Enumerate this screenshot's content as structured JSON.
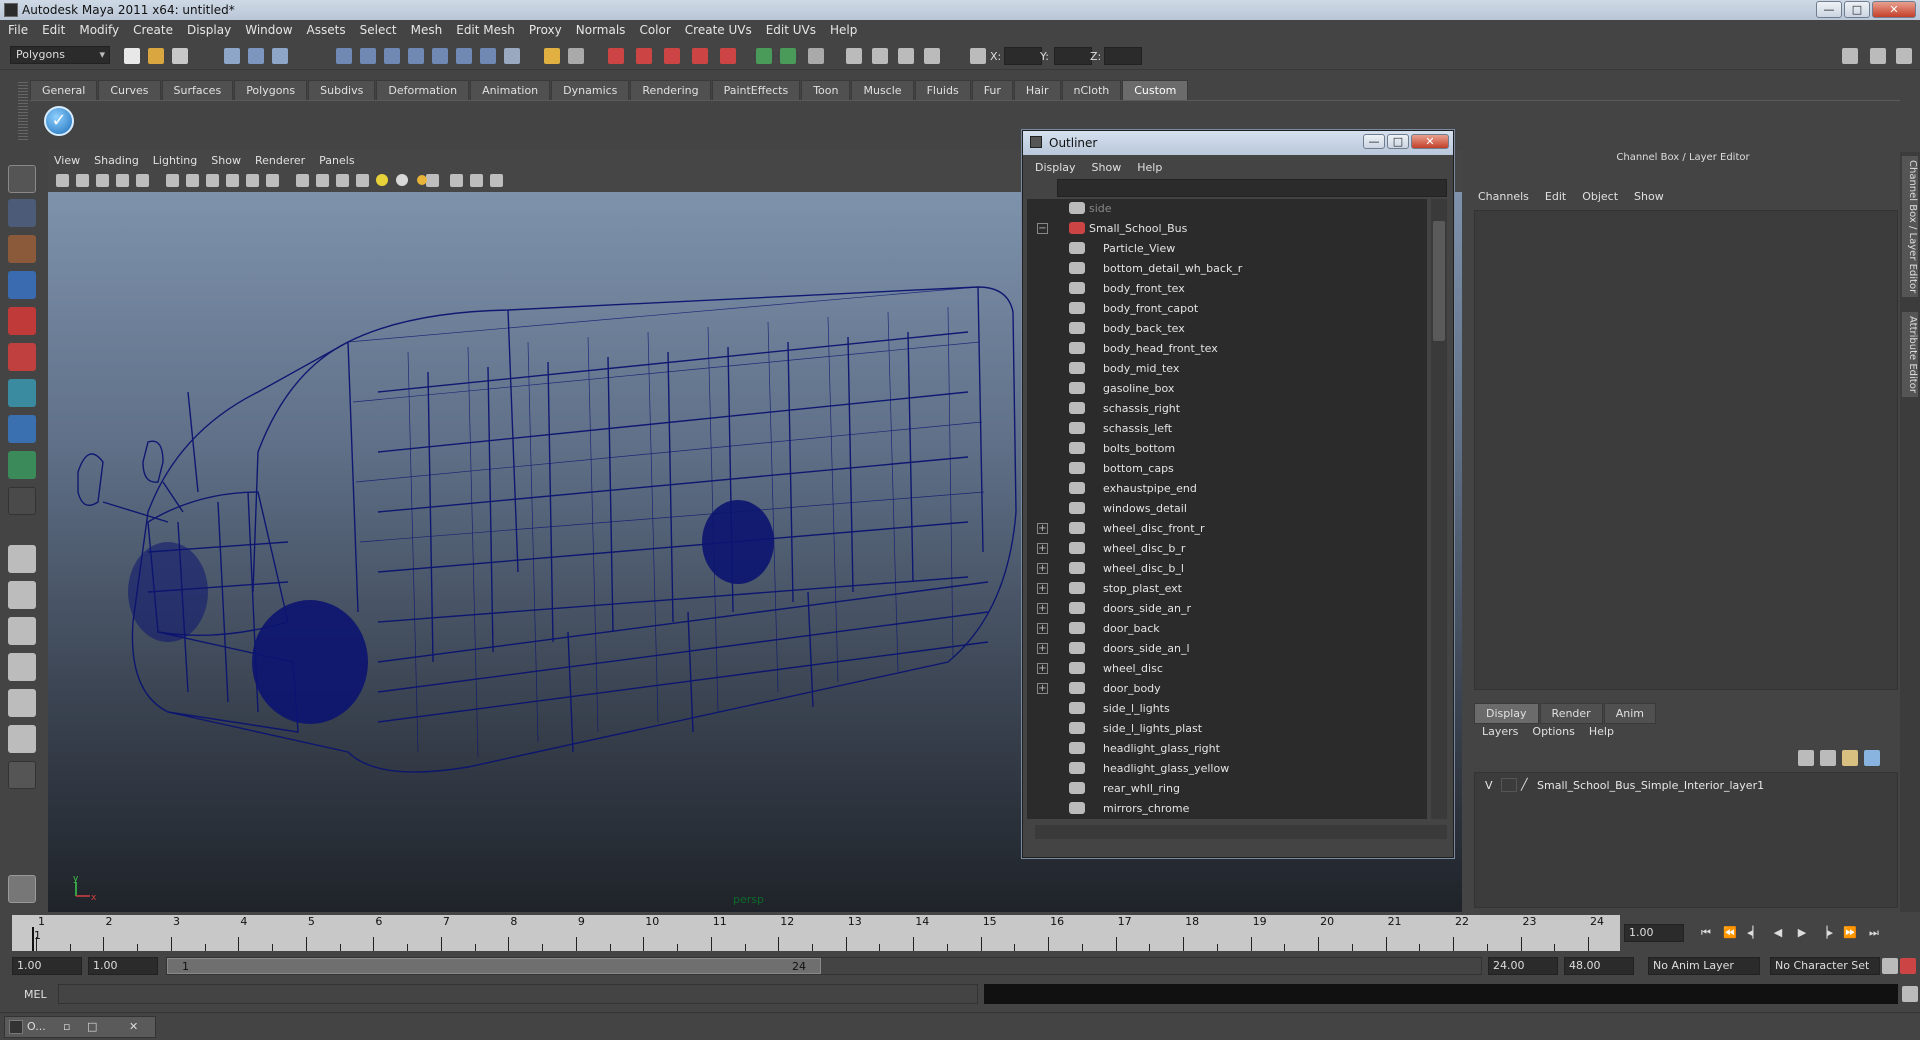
{
  "window": {
    "title": "Autodesk Maya 2011 x64: untitled*"
  },
  "menubar": [
    "File",
    "Edit",
    "Modify",
    "Create",
    "Display",
    "Window",
    "Assets",
    "Select",
    "Mesh",
    "Edit Mesh",
    "Proxy",
    "Normals",
    "Color",
    "Create UVs",
    "Edit UVs",
    "Help"
  ],
  "statusline": {
    "mode": "Polygons",
    "x_label": "X:",
    "y_label": "Y:",
    "z_label": "Z:"
  },
  "shelf_tabs": [
    "General",
    "Curves",
    "Surfaces",
    "Polygons",
    "Subdivs",
    "Deformation",
    "Animation",
    "Dynamics",
    "Rendering",
    "PaintEffects",
    "Toon",
    "Muscle",
    "Fluids",
    "Fur",
    "Hair",
    "nCloth",
    "Custom"
  ],
  "shelf_active": "Custom",
  "viewport": {
    "menu": [
      "View",
      "Shading",
      "Lighting",
      "Show",
      "Renderer",
      "Panels"
    ],
    "camera": "persp",
    "axis_y": "y",
    "axis_x": "x"
  },
  "outliner": {
    "title": "Outliner",
    "menu": [
      "Display",
      "Show",
      "Help"
    ],
    "items": [
      {
        "label": "side",
        "indent": 0,
        "dim": true,
        "expand": ""
      },
      {
        "label": "Small_School_Bus",
        "indent": 1,
        "dim": false,
        "expand": "−"
      },
      {
        "label": "Particle_View",
        "indent": 2,
        "dim": false,
        "expand": ""
      },
      {
        "label": "bottom_detail_wh_back_r",
        "indent": 2,
        "dim": false,
        "expand": ""
      },
      {
        "label": "body_front_tex",
        "indent": 2,
        "dim": false,
        "expand": ""
      },
      {
        "label": "body_front_capot",
        "indent": 2,
        "dim": false,
        "expand": ""
      },
      {
        "label": "body_back_tex",
        "indent": 2,
        "dim": false,
        "expand": ""
      },
      {
        "label": "body_head_front_tex",
        "indent": 2,
        "dim": false,
        "expand": ""
      },
      {
        "label": "body_mid_tex",
        "indent": 2,
        "dim": false,
        "expand": ""
      },
      {
        "label": "gasoline_box",
        "indent": 2,
        "dim": false,
        "expand": ""
      },
      {
        "label": "schassis_right",
        "indent": 2,
        "dim": false,
        "expand": ""
      },
      {
        "label": "schassis_left",
        "indent": 2,
        "dim": false,
        "expand": ""
      },
      {
        "label": "bolts_bottom",
        "indent": 2,
        "dim": false,
        "expand": ""
      },
      {
        "label": "bottom_caps",
        "indent": 2,
        "dim": false,
        "expand": ""
      },
      {
        "label": "exhaustpipe_end",
        "indent": 2,
        "dim": false,
        "expand": ""
      },
      {
        "label": "windows_detail",
        "indent": 2,
        "dim": false,
        "expand": ""
      },
      {
        "label": "wheel_disc_front_r",
        "indent": 2,
        "dim": false,
        "expand": "+"
      },
      {
        "label": "wheel_disc_b_r",
        "indent": 2,
        "dim": false,
        "expand": "+"
      },
      {
        "label": "wheel_disc_b_l",
        "indent": 2,
        "dim": false,
        "expand": "+"
      },
      {
        "label": "stop_plast_ext",
        "indent": 2,
        "dim": false,
        "expand": "+"
      },
      {
        "label": "doors_side_an_r",
        "indent": 2,
        "dim": false,
        "expand": "+"
      },
      {
        "label": "door_back",
        "indent": 2,
        "dim": false,
        "expand": "+"
      },
      {
        "label": "doors_side_an_l",
        "indent": 2,
        "dim": false,
        "expand": "+"
      },
      {
        "label": "wheel_disc",
        "indent": 2,
        "dim": false,
        "expand": "+"
      },
      {
        "label": "door_body",
        "indent": 2,
        "dim": false,
        "expand": "+"
      },
      {
        "label": "side_l_lights",
        "indent": 2,
        "dim": false,
        "expand": ""
      },
      {
        "label": "side_l_lights_plast",
        "indent": 2,
        "dim": false,
        "expand": ""
      },
      {
        "label": "headlight_glass_right",
        "indent": 2,
        "dim": false,
        "expand": ""
      },
      {
        "label": "headlight_glass_yellow",
        "indent": 2,
        "dim": false,
        "expand": ""
      },
      {
        "label": "rear_whll_ring",
        "indent": 2,
        "dim": false,
        "expand": ""
      },
      {
        "label": "mirrors_chrome",
        "indent": 2,
        "dim": false,
        "expand": ""
      }
    ]
  },
  "channelbox": {
    "title": "Channel Box / Layer Editor",
    "menu": [
      "Channels",
      "Edit",
      "Object",
      "Show"
    ],
    "layer_tabs": [
      "Display",
      "Render",
      "Anim"
    ],
    "layer_menu": [
      "Layers",
      "Options",
      "Help"
    ],
    "layer": {
      "visible": "V",
      "name": "Small_School_Bus_Simple_Interior_layer1"
    }
  },
  "side_tabs": [
    "Channel Box / Layer Editor",
    "Attribute Editor"
  ],
  "timeline": {
    "ticks": [
      "1",
      "2",
      "3",
      "4",
      "5",
      "6",
      "7",
      "8",
      "9",
      "10",
      "11",
      "12",
      "13",
      "14",
      "15",
      "16",
      "17",
      "18",
      "19",
      "20",
      "21",
      "22",
      "23",
      "24"
    ],
    "current_frame": "1",
    "current_time": "1.00"
  },
  "range": {
    "start": "1.00",
    "anim_start": "1.00",
    "range_start_label": "1",
    "range_end_label": "24",
    "end": "24.00",
    "anim_end": "48.00",
    "anim_layer": "No Anim Layer",
    "char_set": "No Character Set"
  },
  "cmdline": {
    "mode": "MEL"
  },
  "taskbar": {
    "item": "O..."
  },
  "colors": {
    "wireframe": "#0b1470",
    "background": "#444444"
  }
}
